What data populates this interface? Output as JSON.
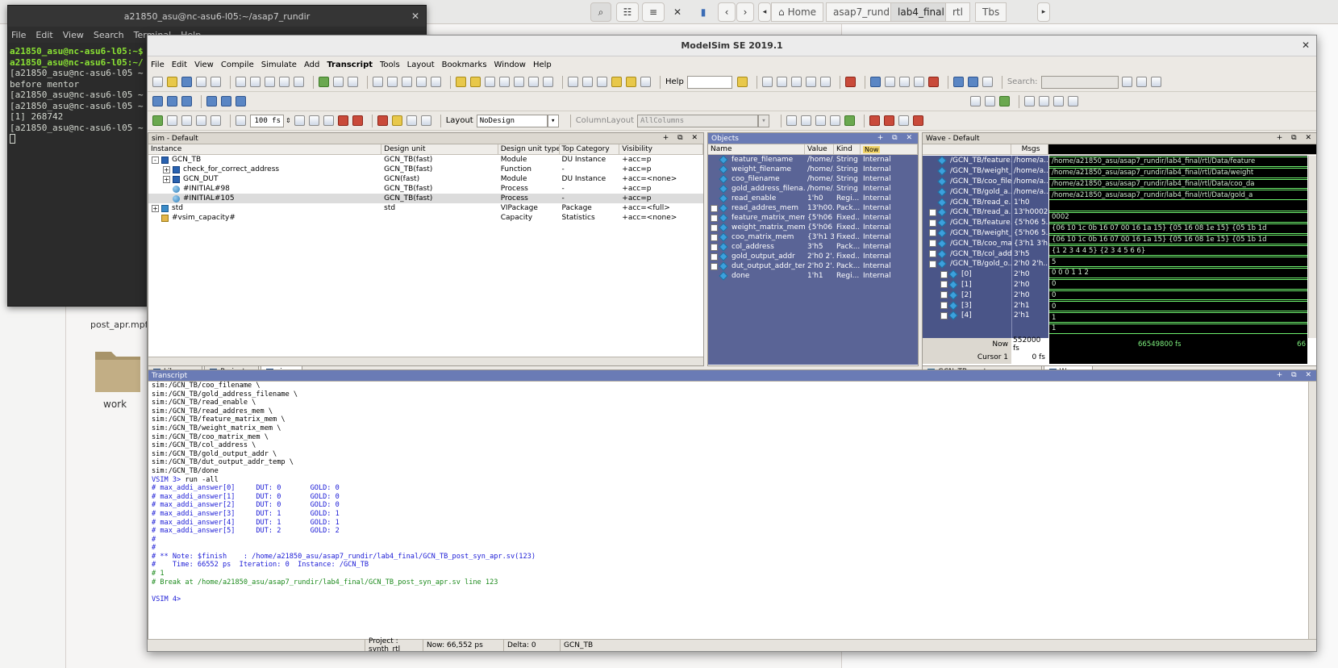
{
  "file_manager": {
    "breadcrumbs": [
      "Home",
      "asap7_rundir",
      "lab4_final",
      "rtl",
      "Tbs"
    ],
    "active_crumb": "lab4_final",
    "items": [
      {
        "label": "post_apr.mpf",
        "kind": "file"
      },
      {
        "label": "work",
        "kind": "folder"
      }
    ]
  },
  "terminal": {
    "title": "a21850_asu@nc-asu6-l05:~/asap7_rundir",
    "menu": [
      "File",
      "Edit",
      "View",
      "Search",
      "Terminal",
      "Help"
    ],
    "lines": [
      {
        "prompt": "a21850_asu@nc-asu6-l05:~$",
        "text": ""
      },
      {
        "prompt": "a21850_asu@nc-asu6-l05:~/",
        "text": ""
      },
      {
        "prompt": "",
        "text": "[a21850_asu@nc-asu6-l05 ~"
      },
      {
        "prompt": "",
        "text": "before mentor"
      },
      {
        "prompt": "",
        "text": "[a21850_asu@nc-asu6-l05 ~"
      },
      {
        "prompt": "",
        "text": "[a21850_asu@nc-asu6-l05 ~"
      },
      {
        "prompt": "",
        "text": "[1] 268742"
      },
      {
        "prompt": "",
        "text": "[a21850_asu@nc-asu6-l05 ~"
      }
    ]
  },
  "modelsim": {
    "title": "ModelSim SE 2019.1",
    "menu": [
      "File",
      "Edit",
      "View",
      "Compile",
      "Simulate",
      "Add",
      "Transcript",
      "Tools",
      "Layout",
      "Bookmarks",
      "Window",
      "Help"
    ],
    "toolbar": {
      "help_label": "Help",
      "search_label": "Search:",
      "run_length": "100 fs",
      "layout_label": "Layout",
      "layout_value": "NoDesign",
      "column_layout_label": "ColumnLayout",
      "column_layout_value": "AllColumns"
    },
    "sim_pane": {
      "title": "sim - Default",
      "columns": [
        "Instance",
        "Design unit",
        "Design unit type",
        "Top Category",
        "Visibility"
      ],
      "rows": [
        {
          "indent": 0,
          "exp": "-",
          "icon": "mod",
          "instance": "GCN_TB",
          "unit": "GCN_TB(fast)",
          "type": "Module",
          "cat": "DU Instance",
          "vis": "+acc=p"
        },
        {
          "indent": 1,
          "exp": "+",
          "icon": "mod",
          "instance": "check_for_correct_address",
          "unit": "GCN_TB(fast)",
          "type": "Function",
          "cat": "-",
          "vis": "+acc=p"
        },
        {
          "indent": 1,
          "exp": "+",
          "icon": "mod",
          "instance": "GCN_DUT",
          "unit": "GCN(fast)",
          "type": "Module",
          "cat": "DU Instance",
          "vis": "+acc=<none>"
        },
        {
          "indent": 1,
          "exp": "",
          "icon": "proc",
          "instance": "#INITIAL#98",
          "unit": "GCN_TB(fast)",
          "type": "Process",
          "cat": "-",
          "vis": "+acc=p"
        },
        {
          "indent": 1,
          "exp": "",
          "icon": "proc",
          "instance": "#INITIAL#105",
          "unit": "GCN_TB(fast)",
          "type": "Process",
          "cat": "-",
          "vis": "+acc=p"
        },
        {
          "indent": 0,
          "exp": "+",
          "icon": "pkg",
          "instance": "std",
          "unit": "std",
          "type": "VIPackage",
          "cat": "Package",
          "vis": "+acc=<full>"
        },
        {
          "indent": 0,
          "exp": "",
          "icon": "cap",
          "instance": "#vsim_capacity#",
          "unit": "",
          "type": "Capacity",
          "cat": "Statistics",
          "vis": "+acc=<none>"
        }
      ],
      "tabs": [
        "Library",
        "Project",
        "sim"
      ],
      "active_tab": "sim"
    },
    "objects_pane": {
      "title": "Objects",
      "filter_label": "Now",
      "columns": [
        "Name",
        "Value",
        "Kind",
        "Mode"
      ],
      "rows": [
        {
          "exp": "",
          "name": "feature_filename",
          "value": "/home/...",
          "kind": "String",
          "mode": "Internal"
        },
        {
          "exp": "",
          "name": "weight_filename",
          "value": "/home/...",
          "kind": "String",
          "mode": "Internal"
        },
        {
          "exp": "",
          "name": "coo_filename",
          "value": "/home/...",
          "kind": "String",
          "mode": "Internal"
        },
        {
          "exp": "",
          "name": "gold_address_filena...",
          "value": "/home/...",
          "kind": "String",
          "mode": "Internal"
        },
        {
          "exp": "",
          "name": "read_enable",
          "value": "1'h0",
          "kind": "Regi...",
          "mode": "Internal"
        },
        {
          "exp": "+",
          "name": "read_addres_mem",
          "value": "13'h00...",
          "kind": "Pack...",
          "mode": "Internal"
        },
        {
          "exp": "+",
          "name": "feature_matrix_mem",
          "value": "{5'h06 ...",
          "kind": "Fixed...",
          "mode": "Internal"
        },
        {
          "exp": "+",
          "name": "weight_matrix_mem",
          "value": "{5'h06 ...",
          "kind": "Fixed...",
          "mode": "Internal"
        },
        {
          "exp": "+",
          "name": "coo_matrix_mem",
          "value": "{3'h1 3...",
          "kind": "Fixed...",
          "mode": "Internal"
        },
        {
          "exp": "+",
          "name": "col_address",
          "value": "3'h5",
          "kind": "Pack...",
          "mode": "Internal"
        },
        {
          "exp": "+",
          "name": "gold_output_addr",
          "value": "2'h0 2'...",
          "kind": "Fixed...",
          "mode": "Internal"
        },
        {
          "exp": "+",
          "name": "dut_output_addr_tem...",
          "value": "2'h0 2'...",
          "kind": "Pack...",
          "mode": "Internal"
        },
        {
          "exp": "",
          "name": "done",
          "value": "1'h1",
          "kind": "Regi...",
          "mode": "Internal"
        }
      ]
    },
    "wave_pane": {
      "title": "Wave - Default",
      "msgs_label": "Msgs",
      "signals": [
        {
          "exp": "",
          "name": "/GCN_TB/feature...",
          "value": "/home/a...",
          "trace": "/home/a21850_asu/asap7_rundir/lab4_final/rtl/Data/feature"
        },
        {
          "exp": "",
          "name": "/GCN_TB/weight_...",
          "value": "/home/a...",
          "trace": "/home/a21850_asu/asap7_rundir/lab4_final/rtl/Data/weight"
        },
        {
          "exp": "",
          "name": "/GCN_TB/coo_file...",
          "value": "/home/a...",
          "trace": "/home/a21850_asu/asap7_rundir/lab4_final/rtl/Data/coo_da"
        },
        {
          "exp": "",
          "name": "/GCN_TB/gold_a...",
          "value": "/home/a...",
          "trace": "/home/a21850_asu/asap7_rundir/lab4_final/rtl/Data/gold_a"
        },
        {
          "exp": "",
          "name": "/GCN_TB/read_e...",
          "value": "1'h0",
          "trace": ""
        },
        {
          "exp": "+",
          "name": "/GCN_TB/read_a...",
          "value": "13'h0002",
          "trace": "0002"
        },
        {
          "exp": "+",
          "name": "/GCN_TB/feature...",
          "value": "{5'h06 5...",
          "trace": "{06 10 1c 0b 16 07 00 16 1a 15} {05 16 08 1e 15} {05 1b 1d"
        },
        {
          "exp": "+",
          "name": "/GCN_TB/weight_...",
          "value": "{5'h06 5...",
          "trace": "{06 10 1c 0b 16 07 00 16 1a 15} {05 16 08 1e 15} {05 1b 1d"
        },
        {
          "exp": "+",
          "name": "/GCN_TB/coo_ma...",
          "value": "{3'h1 3'h...",
          "trace": "{1 2 3 4 4 5} {2 3 4 5 6 6}"
        },
        {
          "exp": "+",
          "name": "/GCN_TB/col_add...",
          "value": "3'h5",
          "trace": "5"
        },
        {
          "exp": "-",
          "name": "/GCN_TB/gold_o...",
          "value": "2'h0 2'h...",
          "trace": "0 0 0 1 1 2"
        },
        {
          "exp": "+",
          "name": "[0]",
          "value": "2'h0",
          "trace": "0"
        },
        {
          "exp": "+",
          "name": "[1]",
          "value": "2'h0",
          "trace": "0"
        },
        {
          "exp": "+",
          "name": "[2]",
          "value": "2'h0",
          "trace": "0"
        },
        {
          "exp": "+",
          "name": "[3]",
          "value": "2'h1",
          "trace": "1"
        },
        {
          "exp": "+",
          "name": "[4]",
          "value": "2'h1",
          "trace": "1"
        }
      ],
      "now_label": "Now",
      "now_value": "552000 fs",
      "cursor_label": "Cursor 1",
      "cursor_value": "0 fs",
      "time_marker": "66549800 fs",
      "time_marker2": "66",
      "tabs": [
        "GCN_TB_post_syn_apr.sv",
        "Wave"
      ],
      "active_tab": "Wave"
    },
    "transcript": {
      "title": "Transcript",
      "lines": [
        {
          "style": "cmd",
          "text": "sim:/GCN_TB/coo_filename \\"
        },
        {
          "style": "cmd",
          "text": "sim:/GCN_TB/gold_address_filename \\"
        },
        {
          "style": "cmd",
          "text": "sim:/GCN_TB/read_enable \\"
        },
        {
          "style": "cmd",
          "text": "sim:/GCN_TB/read_addres_mem \\"
        },
        {
          "style": "cmd",
          "text": "sim:/GCN_TB/feature_matrix_mem \\"
        },
        {
          "style": "cmd",
          "text": "sim:/GCN_TB/weight_matrix_mem \\"
        },
        {
          "style": "cmd",
          "text": "sim:/GCN_TB/coo_matrix_mem \\"
        },
        {
          "style": "cmd",
          "text": "sim:/GCN_TB/col_address \\"
        },
        {
          "style": "cmd",
          "text": "sim:/GCN_TB/gold_output_addr \\"
        },
        {
          "style": "cmd",
          "text": "sim:/GCN_TB/dut_output_addr_temp \\"
        },
        {
          "style": "cmd",
          "text": "sim:/GCN_TB/done"
        },
        {
          "style": "prompt",
          "prompt": "VSIM 3>",
          "text": " run -all"
        },
        {
          "style": "blue",
          "text": "# max_addi_answer[0]     DUT: 0       GOLD: 0"
        },
        {
          "style": "blue",
          "text": "# max_addi_answer[1]     DUT: 0       GOLD: 0"
        },
        {
          "style": "blue",
          "text": "# max_addi_answer[2]     DUT: 0       GOLD: 0"
        },
        {
          "style": "blue",
          "text": "# max_addi_answer[3]     DUT: 1       GOLD: 1"
        },
        {
          "style": "blue",
          "text": "# max_addi_answer[4]     DUT: 1       GOLD: 1"
        },
        {
          "style": "blue",
          "text": "# max_addi_answer[5]     DUT: 2       GOLD: 2"
        },
        {
          "style": "blue",
          "text": "#"
        },
        {
          "style": "blue",
          "text": "#"
        },
        {
          "style": "blue",
          "text": "# ** Note: $finish    : /home/a21850_asu/asap7_rundir/lab4_final/GCN_TB_post_syn_apr.sv(123)"
        },
        {
          "style": "blue",
          "text": "#    Time: 66552 ps  Iteration: 0  Instance: /GCN_TB"
        },
        {
          "style": "green",
          "text": "# 1"
        },
        {
          "style": "green",
          "text": "# Break at /home/a21850_asu/asap7_rundir/lab4_final/GCN_TB_post_syn_apr.sv line 123"
        },
        {
          "style": "blank",
          "text": ""
        },
        {
          "style": "prompt",
          "prompt": "VSIM 4>",
          "text": ""
        }
      ]
    },
    "status": {
      "project": "Project : synth_rtl",
      "now": "Now: 66,552 ps",
      "delta": "Delta: 0",
      "scope": "GCN_TB"
    }
  }
}
